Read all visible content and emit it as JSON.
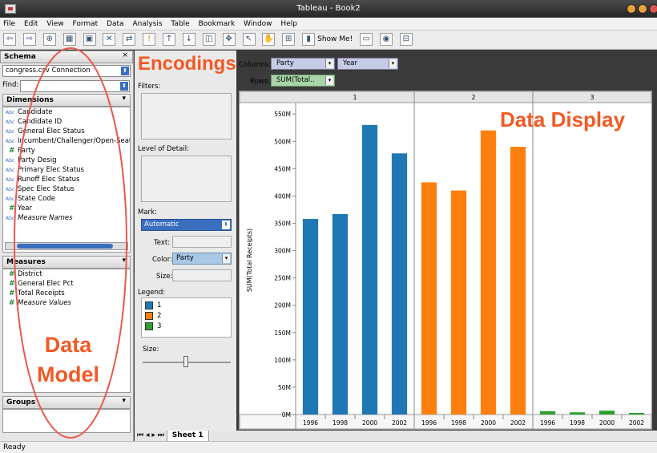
{
  "window": {
    "title": "Tableau - Book2"
  },
  "menu": [
    "File",
    "Edit",
    "View",
    "Format",
    "Data",
    "Analysis",
    "Table",
    "Bookmark",
    "Window",
    "Help"
  ],
  "toolbar": {
    "show_me_label": "Show Me!"
  },
  "schema": {
    "header": "Schema",
    "connection": "congress.csv Connection",
    "find_label": "Find:",
    "dimensions_header": "Dimensions",
    "dimensions": [
      {
        "type": "Abc",
        "name": "Candidate"
      },
      {
        "type": "Abc",
        "name": "Candidate ID"
      },
      {
        "type": "Abc",
        "name": "General Elec Status"
      },
      {
        "type": "Abc",
        "name": "Incumbent/Challenger/Open-Seat"
      },
      {
        "type": "#",
        "name": "Party"
      },
      {
        "type": "Abc",
        "name": "Party Desig"
      },
      {
        "type": "Abc",
        "name": "Primary Elec Status"
      },
      {
        "type": "Abc",
        "name": "Runoff Elec Status"
      },
      {
        "type": "Abc",
        "name": "Spec Elec Status"
      },
      {
        "type": "Abc",
        "name": "State Code"
      },
      {
        "type": "#",
        "name": "Year"
      },
      {
        "type": "Abc",
        "name": "Measure Names"
      }
    ],
    "measures_header": "Measures",
    "measures": [
      {
        "type": "#",
        "name": "District"
      },
      {
        "type": "#",
        "name": "General Elec Pct"
      },
      {
        "type": "#",
        "name": "Total Receipts"
      },
      {
        "type": "#",
        "name": "Measure Values"
      }
    ],
    "groups_header": "Groups"
  },
  "shelves": {
    "columns_label": "Columns:",
    "rows_label": "Rows:",
    "columns": [
      "Party",
      "Year"
    ],
    "rows": [
      "SUM(Total.."
    ],
    "filters_label": "Filters:",
    "level_of_detail_label": "Level of Detail:",
    "mark_label": "Mark:",
    "mark_type": "Automatic",
    "text_label": "Text:",
    "color_label": "Color:",
    "color_value": "Party",
    "size_label": "Size:",
    "legend_label": "Legend:",
    "legend": [
      {
        "label": "1",
        "color": "#1f77b4"
      },
      {
        "label": "2",
        "color": "#ff7f0e"
      },
      {
        "label": "3",
        "color": "#2ca02c"
      }
    ],
    "size_slider_label": "Size:"
  },
  "annotations": {
    "encodings": "Encodings",
    "data_display": "Data Display",
    "data_model_line1": "Data",
    "data_model_line2": "Model"
  },
  "sheet_tab": "Sheet 1",
  "status": "Ready",
  "chart_data": {
    "type": "bar",
    "ylabel": "SUM(Total Receipts)",
    "yticks": [
      "0M",
      "50M",
      "100M",
      "150M",
      "200M",
      "250M",
      "300M",
      "350M",
      "400M",
      "450M",
      "500M",
      "550M"
    ],
    "ylim": [
      0,
      565
    ],
    "panes": [
      {
        "header": "1",
        "color": "#1f77b4",
        "categories": [
          "1996",
          "1998",
          "2000",
          "2002"
        ],
        "values": [
          358,
          367,
          530,
          478
        ]
      },
      {
        "header": "2",
        "color": "#ff7f0e",
        "categories": [
          "1996",
          "1998",
          "2000",
          "2002"
        ],
        "values": [
          425,
          410,
          520,
          490
        ]
      },
      {
        "header": "3",
        "color": "#2ca02c",
        "categories": [
          "1996",
          "1998",
          "2000",
          "2002"
        ],
        "values": [
          6,
          4,
          7,
          3
        ]
      }
    ]
  }
}
